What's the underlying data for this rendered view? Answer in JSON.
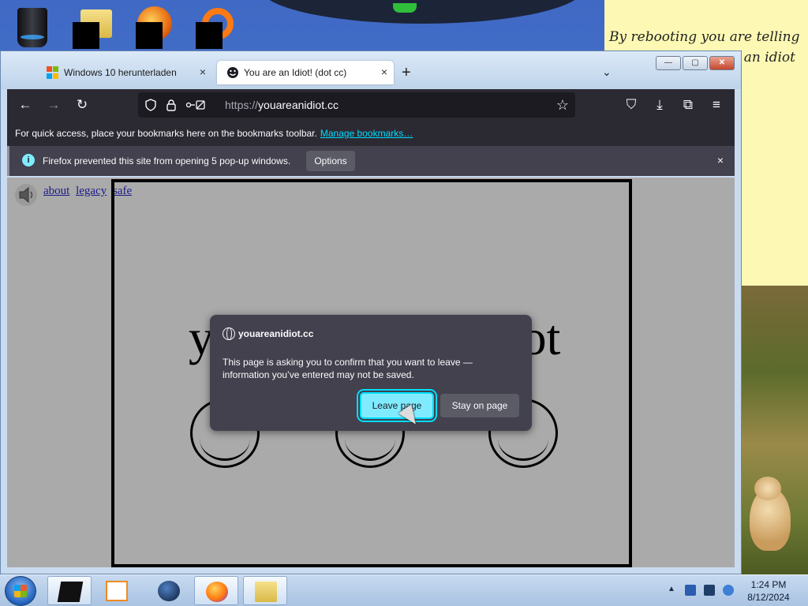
{
  "desktop": {
    "sticky_note": {
      "line1": "By rebooting you are telling",
      "line2": "an idiot"
    }
  },
  "browser": {
    "tabs": [
      {
        "label": "Windows 10 herunterladen",
        "icon": "microsoft-logo-icon",
        "close": "×"
      },
      {
        "label": "You are an Idiot! (dot cc)",
        "icon": "smiley-icon",
        "close": "×",
        "active": true
      }
    ],
    "new_tab": "+",
    "tab_list": "⌄",
    "window_controls": {
      "minimize": "—",
      "maximize": "▢",
      "close": "✕"
    },
    "nav": {
      "back": "←",
      "forward": "→",
      "reload": "↻"
    },
    "url": {
      "protocol": "https://",
      "host": "youareanidiot.cc"
    },
    "toolbar_icons": {
      "star": "☆",
      "pocket": "⛉",
      "download": "⤓",
      "extensions": "⧉",
      "menu": "≡"
    },
    "bookmarks_bar": {
      "text": "For quick access, place your bookmarks here on the bookmarks toolbar.",
      "link": "Manage bookmarks…"
    },
    "notification": {
      "text": "Firefox prevented this site from opening 5 pop-up windows.",
      "options_label": "Options",
      "close": "×"
    }
  },
  "page": {
    "links": [
      "about",
      "legacy",
      "safe"
    ],
    "headline_left": "y",
    "headline_right": "idiot"
  },
  "dialog": {
    "host": "youareanidiot.cc",
    "message": "This page is asking you to confirm that you want to leave — information you’ve entered may not be saved.",
    "leave_label": "Leave page",
    "stay_label": "Stay on page"
  },
  "taskbar": {
    "time": "1:24 PM",
    "date": "8/12/2024",
    "tray_arrow": "▲"
  }
}
